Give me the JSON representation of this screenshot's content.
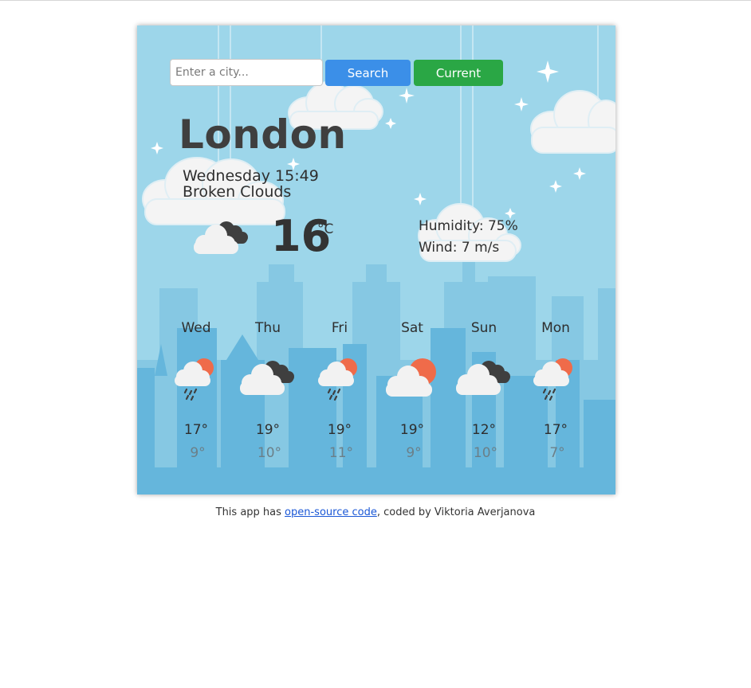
{
  "search": {
    "placeholder": "Enter a city..."
  },
  "buttons": {
    "search_label": "Search",
    "current_label": "Current"
  },
  "current": {
    "city": "London",
    "datetime": "Wednesday 15:49",
    "description": "Broken Clouds",
    "icon": "broken-clouds-icon",
    "temperature": "16",
    "unit": "°C",
    "humidity": "Humidity: 75%",
    "wind": "Wind: 7 m/s"
  },
  "forecast": [
    {
      "day": "Wed",
      "icon": "rain-sun-icon",
      "max": "17°",
      "min": "9°"
    },
    {
      "day": "Thu",
      "icon": "broken-clouds-icon",
      "max": "19°",
      "min": "10°"
    },
    {
      "day": "Fri",
      "icon": "rain-sun-icon",
      "max": "19°",
      "min": "11°"
    },
    {
      "day": "Sat",
      "icon": "partly-sunny-icon",
      "max": "19°",
      "min": "9°"
    },
    {
      "day": "Sun",
      "icon": "broken-clouds-icon",
      "max": "12°",
      "min": "10°"
    },
    {
      "day": "Mon",
      "icon": "rain-sun-icon",
      "max": "17°",
      "min": "7°"
    }
  ],
  "footer": {
    "prefix": "This app has ",
    "link_text": "open-source code",
    "suffix": ", coded by Viktoria Averjanova"
  },
  "colors": {
    "sky": "#9dd6ea",
    "skyline_back": "#86c8e3",
    "skyline_front": "#65b6dc",
    "search_button": "#3b8fe8",
    "current_button": "#2aa745",
    "sun": "#ef6b4a",
    "dark_cloud": "#3f3f3f"
  }
}
